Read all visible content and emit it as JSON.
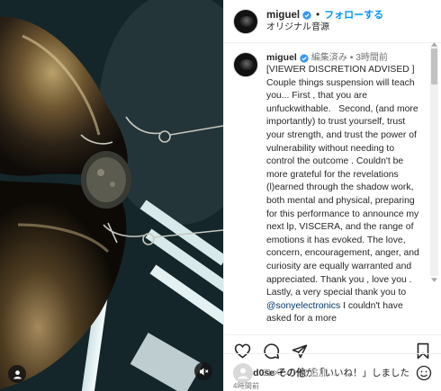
{
  "header": {
    "username": "miguel",
    "dot": "•",
    "follow_label": "フォローする",
    "audio_label": "オリジナル音源"
  },
  "caption": {
    "username": "miguel",
    "edited": "編集済み",
    "sep": "•",
    "time": "3時間前",
    "text": "[VIEWER DISCRETION ADVISED ]\nCouple things suspension will teach you... First , that you are unfuckwithable.   Second, (and more importantly) to trust yourself, trust your strength, and trust the power of vulnerability without needing to control the outcome . Couldn't be more grateful for the revelations (l)earned through the shadow work, both mental and physical, preparing for this performance to announce my next lp, VISCERA, and the range of emotions it has evoked. The love, concern, encouragement, anger, and curiosity are equally warranted and appreciated. Thank you , love you .  Lastly, a very special thank you to ",
    "mention": "@sonyelectronics",
    "text_after": " I couldn't have asked for a more"
  },
  "likes": {
    "user": "ntand0se",
    "others": "その他",
    "suffix": "が「いいね！」しました"
  },
  "time_ago": "4時間前",
  "comment": {
    "placeholder": "コメントを追加..."
  },
  "colors": {
    "accent": "#0095f6",
    "mention": "#00376b",
    "verified": "#3897f0"
  },
  "icons": {
    "like": "heart-icon",
    "comment": "comment-icon",
    "share": "send-icon",
    "save": "bookmark-icon",
    "user_tag": "user-icon",
    "mute": "speaker-muted-icon",
    "emoji": "smile-icon"
  }
}
